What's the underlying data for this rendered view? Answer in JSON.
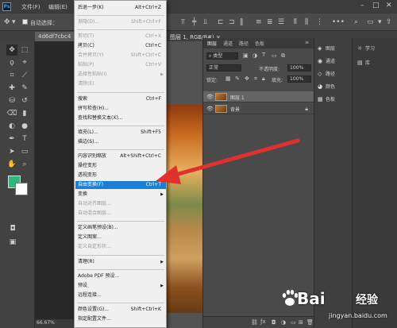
{
  "app": {
    "logo": "Ps"
  },
  "menubar": {
    "file": "文件(F)",
    "edit": "编辑(E)"
  },
  "options": {
    "auto_select": "自动选择："
  },
  "document": {
    "tab": "4d6df7cbc4",
    "tab_right": "图层 1, RGB/8#) ×"
  },
  "edit_menu": {
    "items": [
      {
        "label": "后退一步(K)",
        "shortcut": "Alt+Ctrl+Z",
        "disabled": false
      },
      {
        "label": "渐隐(D)...",
        "shortcut": "Shift+Ctrl+F",
        "disabled": true
      },
      {
        "label": "剪切(T)",
        "shortcut": "Ctrl+X",
        "disabled": true
      },
      {
        "label": "拷贝(C)",
        "shortcut": "Ctrl+C",
        "disabled": false
      },
      {
        "label": "合并拷贝(Y)",
        "shortcut": "Shift+Ctrl+C",
        "disabled": true
      },
      {
        "label": "粘贴(P)",
        "shortcut": "Ctrl+V",
        "disabled": true
      },
      {
        "label": "选择性粘贴(I)",
        "shortcut": "",
        "disabled": true
      },
      {
        "label": "清除(E)",
        "shortcut": "",
        "disabled": true
      },
      {
        "label": "搜索",
        "shortcut": "Ctrl+F",
        "disabled": false
      },
      {
        "label": "拼写检查(H)...",
        "shortcut": "",
        "disabled": false
      },
      {
        "label": "查找和替换文本(X)...",
        "shortcut": "",
        "disabled": false
      },
      {
        "label": "填充(L)...",
        "shortcut": "Shift+F5",
        "disabled": false
      },
      {
        "label": "描边(S)...",
        "shortcut": "",
        "disabled": false
      },
      {
        "label": "内容识别缩放",
        "shortcut": "Alt+Shift+Ctrl+C",
        "disabled": false
      },
      {
        "label": "操控变形",
        "shortcut": "",
        "disabled": false
      },
      {
        "label": "透视变形",
        "shortcut": "",
        "disabled": false
      },
      {
        "label": "自由变换(F)",
        "shortcut": "Ctrl+T",
        "disabled": false,
        "highlighted": true
      },
      {
        "label": "变换",
        "shortcut": "",
        "disabled": false,
        "submenu": true
      },
      {
        "label": "自动对齐图层...",
        "shortcut": "",
        "disabled": true
      },
      {
        "label": "自动混合图层...",
        "shortcut": "",
        "disabled": true
      },
      {
        "label": "定义画笔预设(B)...",
        "shortcut": "",
        "disabled": false
      },
      {
        "label": "定义图案...",
        "shortcut": "",
        "disabled": false
      },
      {
        "label": "定义自定形状...",
        "shortcut": "",
        "disabled": true
      },
      {
        "label": "清理(R)",
        "shortcut": "",
        "disabled": false,
        "submenu": true
      },
      {
        "label": "Adobe PDF 预设...",
        "shortcut": "",
        "disabled": false
      },
      {
        "label": "预设",
        "shortcut": "",
        "disabled": false,
        "submenu": true
      },
      {
        "label": "远程连接...",
        "shortcut": "",
        "disabled": false
      },
      {
        "label": "颜色设置(G)...",
        "shortcut": "Shift+Ctrl+K",
        "disabled": false
      },
      {
        "label": "指定配置文件...",
        "shortcut": "",
        "disabled": false
      }
    ]
  },
  "layers_panel": {
    "tabs": [
      "图层",
      "通道",
      "路径",
      "色板"
    ],
    "kind": "类型",
    "blend_mode": "正常",
    "opacity_label": "不透明度:",
    "opacity": "100%",
    "lock_label": "锁定:",
    "fill_label": "填充:",
    "fill": "100%",
    "layers": [
      {
        "name": "图层 1",
        "selected": true
      },
      {
        "name": "背景",
        "selected": false
      }
    ]
  },
  "mini_panel": {
    "items": [
      "图层",
      "通道",
      "路径",
      "颜色",
      "色板"
    ]
  },
  "far_panel": {
    "items": [
      "学习",
      "库"
    ]
  },
  "status": {
    "zoom": "66.67%"
  },
  "watermark": {
    "brand": "Bai",
    "brand2": "经验",
    "url": "jingyan.baidu.com"
  },
  "colors": {
    "foreground": "#2fb77d",
    "background": "#ffffff",
    "highlight": "#1c7fd6",
    "arrow": "#e0312e"
  }
}
